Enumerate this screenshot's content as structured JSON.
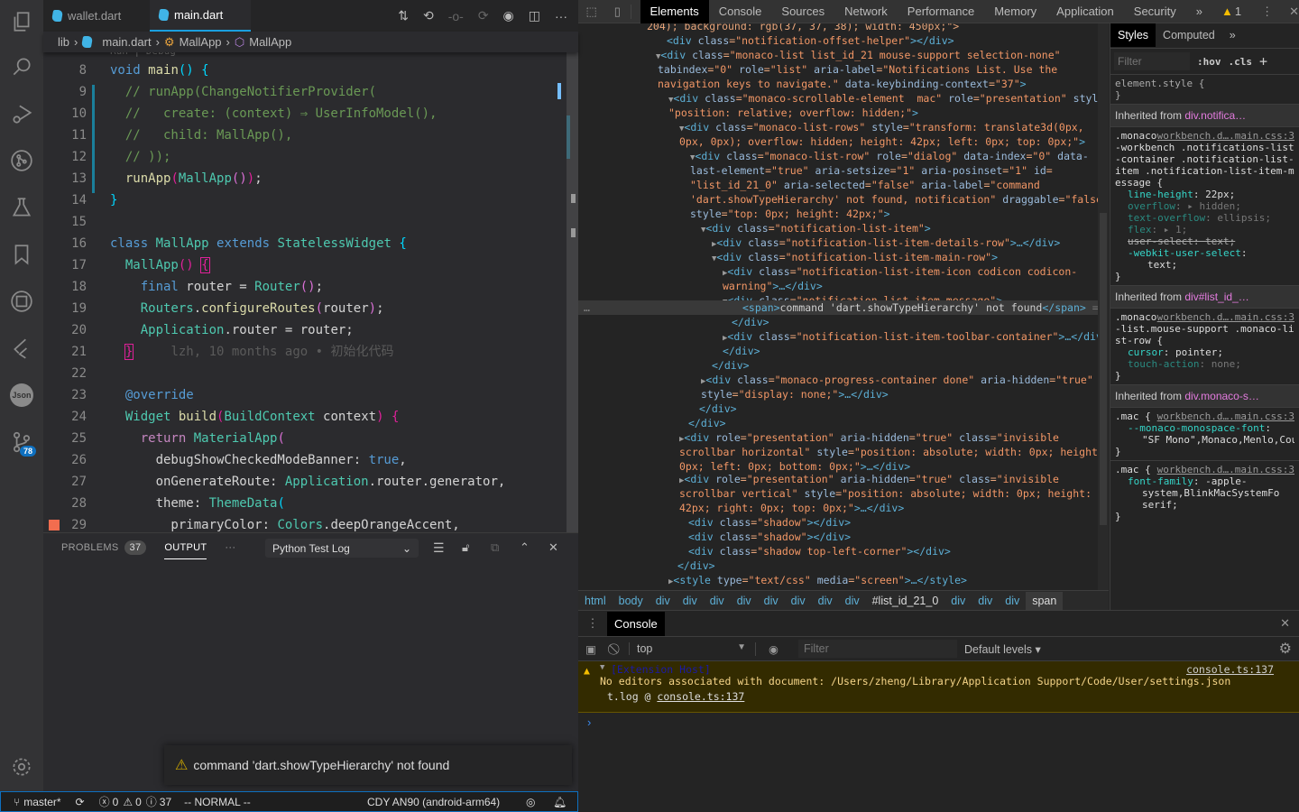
{
  "vscode": {
    "activity": [
      {
        "name": "explorer-icon"
      },
      {
        "name": "search-icon"
      },
      {
        "name": "run-debug-icon"
      },
      {
        "name": "git-graph-icon"
      },
      {
        "name": "testing-icon"
      },
      {
        "name": "bookmark-icon"
      },
      {
        "name": "extension-icon"
      },
      {
        "name": "flutter-icon"
      },
      {
        "name": "json-icon",
        "label": "Json"
      },
      {
        "name": "source-control-icon",
        "badge": "78"
      }
    ],
    "tabs": [
      {
        "label": "wallet.dart",
        "active": false
      },
      {
        "label": "main.dart",
        "active": true
      }
    ],
    "breadcrumb": [
      "lib",
      "main.dart",
      "MallApp",
      "MallApp"
    ],
    "codelens": "Run | Debug",
    "lines": [
      {
        "n": "8"
      },
      {
        "n": "9"
      },
      {
        "n": "10"
      },
      {
        "n": "11"
      },
      {
        "n": "12"
      },
      {
        "n": "13"
      },
      {
        "n": "14"
      },
      {
        "n": "15"
      },
      {
        "n": "16"
      },
      {
        "n": "17"
      },
      {
        "n": "18"
      },
      {
        "n": "19"
      },
      {
        "n": "20"
      },
      {
        "n": "21"
      },
      {
        "n": "22"
      },
      {
        "n": "23"
      },
      {
        "n": "24"
      },
      {
        "n": "25"
      },
      {
        "n": "26"
      },
      {
        "n": "27"
      },
      {
        "n": "28"
      },
      {
        "n": "29"
      }
    ],
    "blame": "lzh, 10 months ago • 初始化代码",
    "panel": {
      "problems_label": "PROBLEMS",
      "problems_count": "37",
      "output_label": "OUTPUT",
      "more": "···",
      "output_channel": "Python Test Log"
    },
    "notification": "command 'dart.showTypeHierarchy' not found",
    "status": {
      "branch": "master*",
      "errors": "0",
      "warnings": "0",
      "info": "37",
      "mode": "-- NORMAL --",
      "device": "CDY AN90 (android-arm64)"
    }
  },
  "devtools": {
    "tabs": [
      "Elements",
      "Console",
      "Sources",
      "Network",
      "Performance",
      "Memory",
      "Application",
      "Security"
    ],
    "active_tab": "Elements",
    "warning_count": "1",
    "breadcrumb": [
      "html",
      "body",
      "div",
      "div",
      "div",
      "div",
      "div",
      "div",
      "div",
      "div",
      "#list_id_21_0",
      "div",
      "div",
      "div",
      "span"
    ],
    "styles": {
      "tabs": [
        "Styles",
        "Computed"
      ],
      "filter_placeholder": "Filter",
      "hov": ":hov",
      "cls": ".cls",
      "element_style": "element.style {",
      "inherit1": "Inherited from ",
      "inherit1_sel": "div.notifica…",
      "src": "workbench.d….main.css:3",
      "rule1_sel": ".monaco-workbench .notifications-list-container .notification-list-item .notification-list-item-message {",
      "inherit2_sel": "div#list_id_…",
      "rule2_sel": ".monaco-list.mouse-support .monaco-list-row {",
      "inherit3_sel": "div.monaco-s…",
      "rule3_sel": ".mac {"
    },
    "console": {
      "title": "Console",
      "context": "top",
      "filter_placeholder": "Filter",
      "levels": "Default levels ▾",
      "source": "[Extension Host]",
      "message": "No editors associated with document: /Users/zheng/Library/Application Support/Code/User/settings.json",
      "file": "console.ts:137",
      "trace": "t.log @ "
    }
  }
}
